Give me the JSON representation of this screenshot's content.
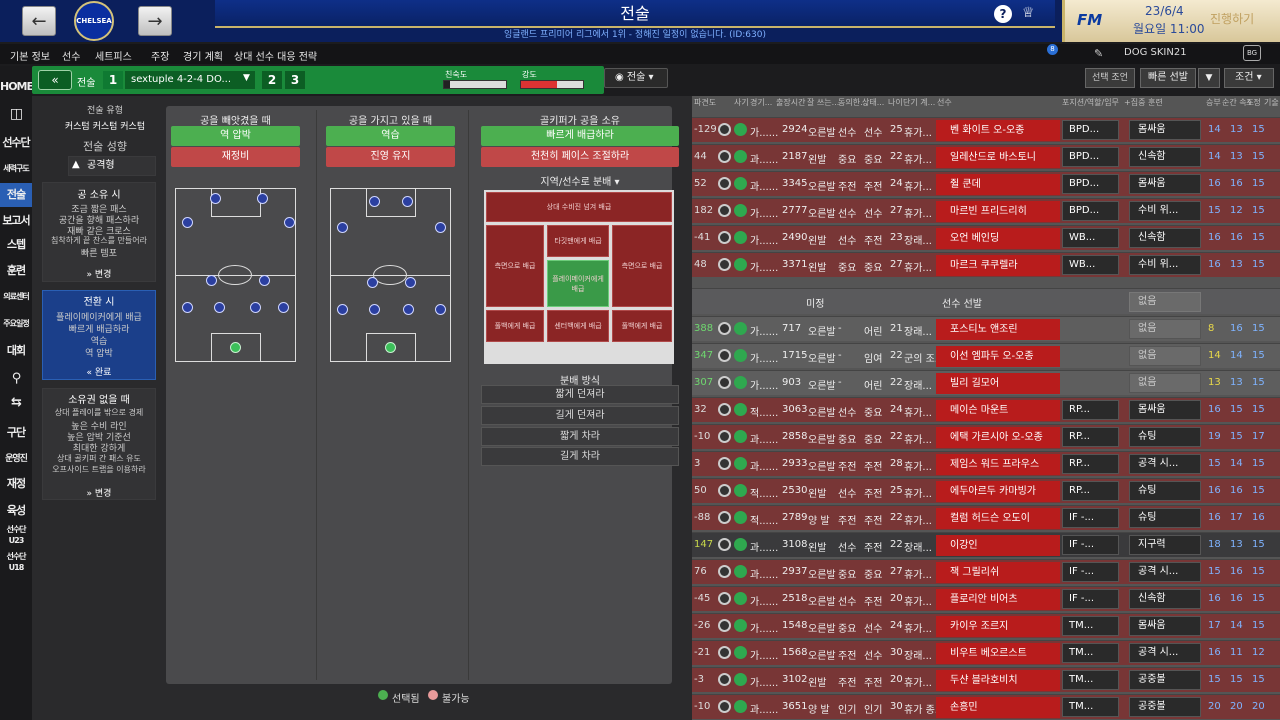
{
  "header": {
    "title": "전술",
    "subtitle": "잉글랜드 프리미어 리그에서 1위 - 정해진 일정이 없습니다. (ID:630)",
    "club_crest": "CHELSEA",
    "date": "23/6/4",
    "time": "월요일 11:00",
    "continue_label": "진행하기",
    "help_icon": "?",
    "fm_logo": "FM"
  },
  "menu": {
    "items": [
      "기본 정보",
      "선수",
      "세트피스",
      "주장",
      "경기 계획",
      "상대 선수 대응 전략"
    ],
    "skin": "DOG SKIN21",
    "logo_box": "BG",
    "badge_count": "8"
  },
  "sidebar": {
    "items": [
      "HOME",
      "",
      "선수단",
      "세력구도",
      "전술",
      "보고서",
      "스텝",
      "훈련",
      "의료센터",
      "주요일정",
      "대회",
      "",
      "",
      "구단",
      "운영진",
      "재정",
      "육성",
      "선수단 U23",
      "선수단 U18"
    ]
  },
  "tactic": {
    "back": "«",
    "label": "전술",
    "num1": "1",
    "formation": "sextuple 4-2-4 DO...",
    "num2": "2",
    "num3": "3",
    "familiarity_label": "친숙도",
    "intensity_label": "강도",
    "dropdown": "전술"
  },
  "left": {
    "style_label": "전술 유형",
    "style_value": "커스텀 커스텀 커스텀",
    "mentality_label": "전술 성향",
    "mentality_value": "공격형",
    "in_possession_title": "공 소유 시",
    "in_possession_items": [
      "조금 짧은 패스",
      "공간을 향해 패스하라",
      "재빠 같은 크로스",
      "침착하게 끝 찬스를 만들어라",
      "빠른 템포"
    ],
    "change1": "변경",
    "transition_title": "전환 시",
    "transition_items": [
      "플레이메이커에게 배급",
      "빠르게 배급하라",
      "역습",
      "역 압박"
    ],
    "done": "완료",
    "out_possession_title": "소유권 없을 때",
    "out_possession_items": [
      "상대 플레이를 밖으로 경제",
      "높은 수비 라인",
      "높은 압박 기준선",
      "최대한 강하게",
      "상대 골키퍼 간 패스 유도",
      "오프사이드 트랩을 이용하라"
    ],
    "change2": "변경"
  },
  "transition": {
    "col1_title": "공을 빼앗겼을 때",
    "col1_btn1": "역 압박",
    "col1_btn2": "재정비",
    "col2_title": "공을 가지고 있을 때",
    "col2_btn1": "역습",
    "col2_btn2": "진영 유지",
    "col3_title": "골키퍼가 공을 소유",
    "col3_btn1": "빠르게 배급하라",
    "col3_btn2": "천천히 페이스 조절하라",
    "distribution_area_label": "지역/선수로 분배",
    "zones": [
      "상대 수비진 넘겨 배급",
      "타깃맨에게 배급",
      "측면으로 배급",
      "플레이메이커에게 배급",
      "측면으로 배급",
      "풀백에게 배급",
      "센터백에게 배급",
      "풀백에게 배급"
    ],
    "dist_method_label": "분배 방식",
    "dist_methods": [
      "짧게 던져라",
      "길게 던져라",
      "짧게 차라",
      "길게 차라"
    ],
    "legend_selected": "선택됨",
    "legend_unavailable": "불가능"
  },
  "roster": {
    "headers": [
      "파견도",
      "사기",
      "경기...",
      "출장시간",
      "잘 쓰는...",
      "동의한...",
      "상태...",
      "나이",
      "단기 계...",
      "선수",
      "포지션/역할/임무",
      "+집중 훈련",
      "승부",
      "순간 속도",
      "조정",
      "기술"
    ],
    "selection_label": "선택 조언",
    "quick_select": "빠른 선발",
    "condition_dd": "조건",
    "sub_divider": "미정",
    "sub_divider2": "선수 선발",
    "rows": [
      {
        "v": "-129",
        "g": "가......",
        "m": "2924",
        "f": "오른발",
        "a": "선수",
        "b": "선수",
        "age": "25",
        "c": "휴가...",
        "name": "벤 화이트 오-오종",
        "pos": "BPD...",
        "role": "몸싸움",
        "s1": "14",
        "s2": "13",
        "s3": "15",
        "type": "starter"
      },
      {
        "v": "44",
        "g": "과......",
        "m": "2187",
        "f": "왼발",
        "a": "중요",
        "b": "중요",
        "age": "22",
        "c": "휴가...",
        "name": "일레산드로 바스토니",
        "pos": "BPD...",
        "role": "신속함",
        "s1": "14",
        "s2": "13",
        "s3": "15",
        "type": "starter"
      },
      {
        "v": "52",
        "g": "과......",
        "m": "3345",
        "f": "오른발",
        "a": "주전",
        "b": "주전",
        "age": "24",
        "c": "휴가...",
        "name": "쥘 쿤데",
        "pos": "BPD...",
        "role": "몸싸움",
        "s1": "16",
        "s2": "16",
        "s3": "15",
        "type": "starter"
      },
      {
        "v": "182",
        "g": "가......",
        "m": "2777",
        "f": "오른발",
        "a": "선수",
        "b": "선수",
        "age": "27",
        "c": "휴가...",
        "name": "마르빈 프리드리히",
        "pos": "BPD...",
        "role": "수비 위...",
        "s1": "15",
        "s2": "12",
        "s3": "15",
        "type": "starter"
      },
      {
        "v": "-41",
        "g": "가......",
        "m": "2490",
        "f": "왼발",
        "a": "선수",
        "b": "주전",
        "age": "23",
        "c": "장래...",
        "name": "오언 베인딩",
        "pos": "WB...",
        "role": "신속함",
        "s1": "16",
        "s2": "16",
        "s3": "15",
        "type": "starter"
      },
      {
        "v": "48",
        "g": "가......",
        "m": "3371",
        "f": "왼발",
        "a": "중요",
        "b": "중요",
        "age": "27",
        "c": "휴가...",
        "name": "마르크 쿠쿠렐라",
        "pos": "WB...",
        "role": "수비 위...",
        "s1": "16",
        "s2": "13",
        "s3": "15",
        "type": "starter"
      },
      {
        "v": "388",
        "g": "가......",
        "m": "717",
        "f": "오른발",
        "a": "-",
        "b": "어린",
        "age": "21",
        "c": "장래...",
        "name": "포스티노 앤조린",
        "pos": "",
        "role": "없음",
        "s1": "8",
        "s2": "16",
        "s3": "15",
        "type": "sub"
      },
      {
        "v": "347",
        "g": "가......",
        "m": "1715",
        "f": "오른발",
        "a": "-",
        "b": "임여",
        "age": "22",
        "c": "군의 조...",
        "name": "이선 엠파두 오-오종",
        "pos": "",
        "role": "없음",
        "s1": "14",
        "s2": "14",
        "s3": "15",
        "type": "sub"
      },
      {
        "v": "307",
        "g": "가......",
        "m": "903",
        "f": "오른발",
        "a": "-",
        "b": "어린",
        "age": "22",
        "c": "장래...",
        "name": "빌리 길모어",
        "pos": "",
        "role": "없음",
        "s1": "13",
        "s2": "13",
        "s3": "15",
        "type": "sub"
      },
      {
        "v": "32",
        "g": "적......",
        "m": "3063",
        "f": "오른발",
        "a": "선수",
        "b": "중요",
        "age": "24",
        "c": "휴가...",
        "name": "메이슨 마운트",
        "pos": "RP...",
        "role": "몸싸움",
        "s1": "16",
        "s2": "15",
        "s3": "15",
        "type": "starter"
      },
      {
        "v": "-10",
        "g": "과......",
        "m": "2858",
        "f": "오른발",
        "a": "중요",
        "b": "중요",
        "age": "22",
        "c": "휴가...",
        "name": "에택 가르시아 오-오종",
        "pos": "RP...",
        "role": "슈팅",
        "s1": "19",
        "s2": "15",
        "s3": "17",
        "type": "starter"
      },
      {
        "v": "3",
        "g": "과......",
        "m": "2933",
        "f": "오른발",
        "a": "주전",
        "b": "주전",
        "age": "28",
        "c": "휴가...",
        "name": "제임스 워드 프라우스",
        "pos": "RP...",
        "role": "공격 시...",
        "s1": "15",
        "s2": "14",
        "s3": "15",
        "type": "starter"
      },
      {
        "v": "50",
        "g": "적......",
        "m": "2530",
        "f": "왼발",
        "a": "선수",
        "b": "주전",
        "age": "25",
        "c": "휴가...",
        "name": "에두아르두 카마빙가",
        "pos": "RP...",
        "role": "슈팅",
        "s1": "16",
        "s2": "16",
        "s3": "15",
        "type": "starter"
      },
      {
        "v": "-88",
        "g": "적......",
        "m": "2789",
        "f": "양 발",
        "a": "주전",
        "b": "주전",
        "age": "22",
        "c": "휴가...",
        "name": "컬럼 허드슨 오도이",
        "pos": "IF -...",
        "role": "슈팅",
        "s1": "16",
        "s2": "17",
        "s3": "16",
        "type": "starter"
      },
      {
        "v": "147",
        "g": "과......",
        "m": "3108",
        "f": "왼발",
        "a": "선수",
        "b": "주전",
        "age": "22",
        "c": "장래...",
        "name": "이강인",
        "pos": "IF -...",
        "role": "지구력",
        "s1": "18",
        "s2": "13",
        "s3": "15",
        "type": "alt"
      },
      {
        "v": "76",
        "g": "과......",
        "m": "2937",
        "f": "오른발",
        "a": "중요",
        "b": "중요",
        "age": "27",
        "c": "휴가...",
        "name": "잭 그릴리쉬",
        "pos": "IF -...",
        "role": "공격 시...",
        "s1": "15",
        "s2": "16",
        "s3": "15",
        "type": "starter"
      },
      {
        "v": "-45",
        "g": "가......",
        "m": "2518",
        "f": "오른발",
        "a": "선수",
        "b": "주전",
        "age": "20",
        "c": "휴가...",
        "name": "플로리안 비어츠",
        "pos": "IF -...",
        "role": "신속함",
        "s1": "16",
        "s2": "16",
        "s3": "15",
        "type": "starter"
      },
      {
        "v": "-26",
        "g": "가......",
        "m": "1548",
        "f": "오른발",
        "a": "중요",
        "b": "선수",
        "age": "24",
        "c": "휴가...",
        "name": "카이우 조르지",
        "pos": "TM...",
        "role": "몸싸움",
        "s1": "17",
        "s2": "14",
        "s3": "15",
        "type": "starter"
      },
      {
        "v": "-21",
        "g": "가......",
        "m": "1568",
        "f": "오른발",
        "a": "주전",
        "b": "선수",
        "age": "30",
        "c": "장래...",
        "name": "비우트 베오르스트",
        "pos": "TM...",
        "role": "공격 시...",
        "s1": "16",
        "s2": "11",
        "s3": "12",
        "type": "starter"
      },
      {
        "v": "-3",
        "g": "가......",
        "m": "3102",
        "f": "왼발",
        "a": "주전",
        "b": "주전",
        "age": "20",
        "c": "휴가...",
        "name": "두샨 블라호비치",
        "pos": "TM...",
        "role": "공중볼",
        "s1": "15",
        "s2": "15",
        "s3": "15",
        "type": "starter"
      },
      {
        "v": "-10",
        "g": "과......",
        "m": "3651",
        "f": "양 발",
        "a": "인기",
        "b": "인기",
        "age": "30",
        "c": "휴가 종...",
        "name": "손흥민",
        "pos": "TM...",
        "role": "공중볼",
        "s1": "20",
        "s2": "20",
        "s3": "20",
        "type": "starter"
      }
    ]
  },
  "colors": {
    "brand": "#0b1f5c",
    "accent": "#1a8a3a",
    "selected": "#4caf50",
    "unavailable": "#c04848"
  }
}
